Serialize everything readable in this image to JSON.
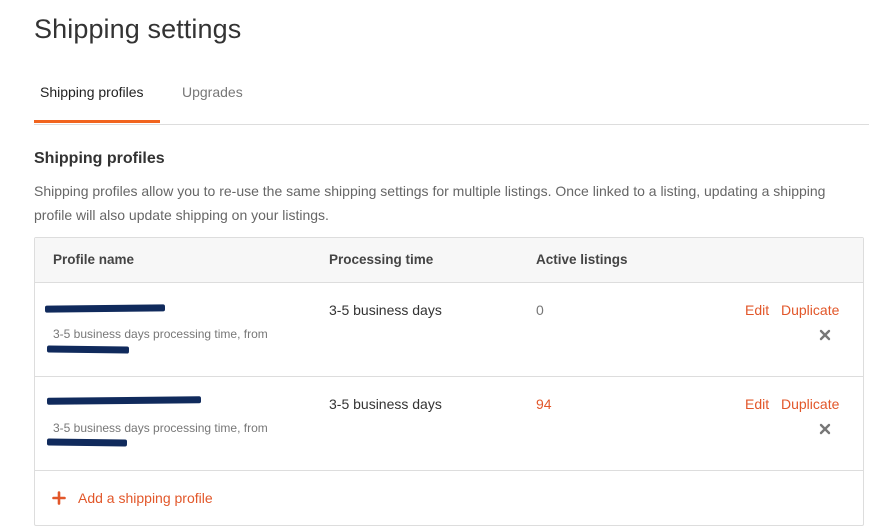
{
  "page": {
    "title": "Shipping settings"
  },
  "tabs": [
    {
      "label": "Shipping profiles",
      "active": true
    },
    {
      "label": "Upgrades",
      "active": false
    }
  ],
  "section": {
    "heading": "Shipping profiles",
    "description": "Shipping profiles allow you to re-use the same shipping settings for multiple listings. Once linked to a listing, updating a shipping profile will also update shipping on your listings."
  },
  "table": {
    "columns": [
      "Profile name",
      "Processing time",
      "Active listings"
    ],
    "rows": [
      {
        "name_redacted": true,
        "description": "3-5 business days processing time, from",
        "processing_time": "3-5 business days",
        "active_listings": "0",
        "edit_label": "Edit",
        "duplicate_label": "Duplicate",
        "remove_icon": "close-icon"
      },
      {
        "name_redacted": true,
        "description": "3-5 business days processing time, from",
        "processing_time": "3-5 business days",
        "active_listings": "94",
        "edit_label": "Edit",
        "duplicate_label": "Duplicate",
        "remove_icon": "close-icon"
      }
    ]
  },
  "add_profile": {
    "label": "Add a shipping profile",
    "icon": "plus-icon"
  },
  "colors": {
    "accent": "#f1641e",
    "link": "#e2572a",
    "redaction": "#102a5c",
    "zero_count": "#777777",
    "active_count": "#e2572a"
  }
}
